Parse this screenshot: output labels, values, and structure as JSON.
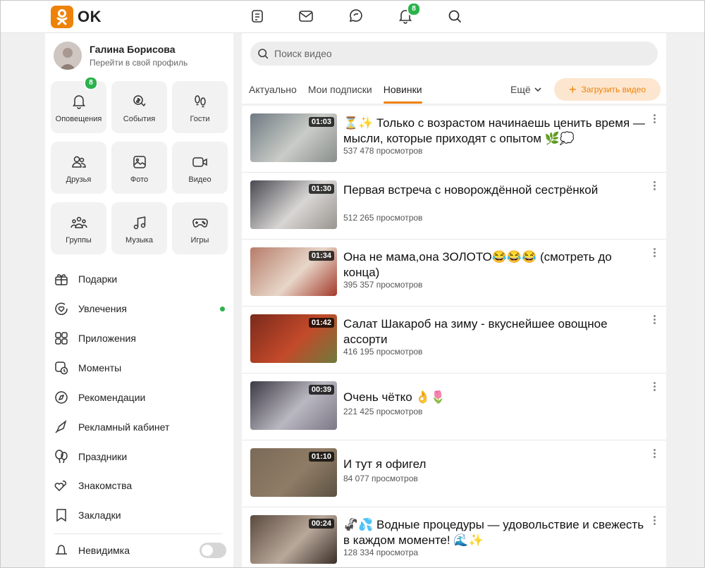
{
  "app": {
    "logo_text": "OK",
    "brand_color": "#ee8208",
    "badge_color": "#2bb24c"
  },
  "topnav": {
    "icons": [
      "notes-icon",
      "mail-icon",
      "chat-icon",
      "bell-icon",
      "search-icon"
    ],
    "bell_badge": "8"
  },
  "profile": {
    "name": "Галина Борисова",
    "subtitle": "Перейти в свой профиль"
  },
  "tiles": [
    {
      "label": "Оповещения",
      "icon": "bell-icon",
      "badge": "8"
    },
    {
      "label": "События",
      "icon": "coins-icon"
    },
    {
      "label": "Гости",
      "icon": "footprints-icon"
    },
    {
      "label": "Друзья",
      "icon": "friends-icon"
    },
    {
      "label": "Фото",
      "icon": "photo-icon"
    },
    {
      "label": "Видео",
      "icon": "video-camera-icon"
    },
    {
      "label": "Группы",
      "icon": "groups-icon"
    },
    {
      "label": "Музыка",
      "icon": "music-note-icon"
    },
    {
      "label": "Игры",
      "icon": "gamepad-icon"
    }
  ],
  "nav": [
    {
      "label": "Подарки",
      "icon": "gift-icon"
    },
    {
      "label": "Увлечения",
      "icon": "heart-circle-icon",
      "dot": true
    },
    {
      "label": "Приложения",
      "icon": "apps-grid-icon"
    },
    {
      "label": "Моменты",
      "icon": "moments-icon"
    },
    {
      "label": "Рекомендации",
      "icon": "compass-icon"
    },
    {
      "label": "Рекламный кабинет",
      "icon": "rocket-icon"
    },
    {
      "label": "Праздники",
      "icon": "balloons-icon"
    },
    {
      "label": "Знакомства",
      "icon": "hearts-icon"
    },
    {
      "label": "Закладки",
      "icon": "bookmark-icon"
    }
  ],
  "invisible": {
    "label": "Невидимка",
    "icon": "hat-icon",
    "enabled": false
  },
  "search": {
    "placeholder": "Поиск видео"
  },
  "tabs": [
    {
      "label": "Актуально",
      "active": false
    },
    {
      "label": "Мои подписки",
      "active": false
    },
    {
      "label": "Новинки",
      "active": true
    }
  ],
  "more_label": "Ещё",
  "upload_label": "Загрузить видео",
  "videos": [
    {
      "duration": "01:03",
      "title": "⏳✨ Только с возрастом начинаешь ценить время — мысли, которые приходят с опытом 🌿💭",
      "views": "537 478 просмотров",
      "thumb": [
        "#6f7a82",
        "#c9ccc7",
        "#8a8f8c"
      ]
    },
    {
      "duration": "01:30",
      "title": "Первая встреча с новорождённой сестрёнкой",
      "views": "512 265 просмотров",
      "thumb": [
        "#4a4a52",
        "#d8d6d4",
        "#9a948f"
      ]
    },
    {
      "duration": "01:34",
      "title": "Она не мама,она ЗОЛОТО😂😂😂 (смотреть до конца)",
      "views": "395 357 просмотров",
      "thumb": [
        "#b77c6a",
        "#e7d6c8",
        "#a33a2b"
      ]
    },
    {
      "duration": "01:42",
      "title": "Салат Шакароб на зиму - вкуснейшее овощное ассорти",
      "views": "416 195 просмотров",
      "thumb": [
        "#7b2a1c",
        "#c34a2a",
        "#6e7a3c"
      ]
    },
    {
      "duration": "00:39",
      "title": "Очень чётко 👌🌷",
      "views": "221 425 просмотров",
      "thumb": [
        "#3d3a45",
        "#b9b7bf",
        "#7c7888"
      ]
    },
    {
      "duration": "01:10",
      "title": "И тут я офигел",
      "views": "84 077 просмотров",
      "thumb": [
        "#7a6a58",
        "#8f7c66",
        "#5d5143"
      ]
    },
    {
      "duration": "00:24",
      "title": "🦨💦 Водные процедуры — удовольствие и свежесть в каждом моменте! 🌊✨",
      "views": "128 334 просмотра",
      "thumb": [
        "#5b4a3e",
        "#b8a89a",
        "#3a2e27"
      ]
    }
  ]
}
